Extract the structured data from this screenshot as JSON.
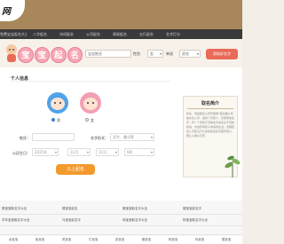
{
  "header": {
    "logo_text": "网"
  },
  "nav": {
    "items": [
      "免费宝宝起名大全",
      "八字起名",
      "诗词起名",
      "公司起名",
      "周易起名",
      "五行起名",
      "名字打分",
      "",
      ""
    ]
  },
  "banner": {
    "title_chars": [
      "宝",
      "宝",
      "起",
      "名"
    ],
    "surname_label": "宝宝姓氏",
    "gender_label": "性别",
    "gender_value": "女",
    "single_double_label": "单双",
    "single_double_value": "双名",
    "cta": "帮助好名字"
  },
  "form": {
    "section_title": "个人信息",
    "gender_options": {
      "male": "男",
      "female": "女",
      "selected": "male"
    },
    "surname_label": "姓氏：",
    "name_type_label": "名字形式：",
    "name_type_value": "双字、叠词等",
    "calendar_label": "公历生日：",
    "year_value": "2025年",
    "month_value": "11月",
    "day_value": "11日",
    "hour_value": "0时",
    "submit": "马上起名"
  },
  "side_panel": {
    "title": "取名简介",
    "text": "新生、有些取名从何开始呢?首先要从传统文化入手，提供了有意义、有寓意的名字，同一个意思不同的名字会完全不同的命运，也会影响孩子未来的生活。合理配置八字和五行让你的宝宝名字更有意义，更让人难以忘怀。"
  },
  "list": {
    "rows": [
      [
        "猴宝宝取名字大全",
        "猴宝宝起名",
        "猪宝宝取名字大全",
        "猪宝宝起名字"
      ],
      [
        "羊年宝宝取名字大全",
        "马宝宝起名字",
        "鸡宝宝取名字大全",
        "狗宝宝取名字大全"
      ],
      [
        "",
        "",
        "",
        ""
      ]
    ],
    "bottom": [
      "龙宝宝",
      "兔宝宝",
      "虎宝宝",
      "牛宝宝",
      "鼠宝宝",
      "猪宝宝",
      "狗宝宝",
      "鸡宝宝",
      "猴宝宝"
    ]
  },
  "colors": {
    "topbar": "#a8875a",
    "nav": "#3a3a3a",
    "cta_top": "#e86a57",
    "cta_main": "#f39a2c",
    "male": "#4fa3e8",
    "female": "#f29fb4"
  }
}
